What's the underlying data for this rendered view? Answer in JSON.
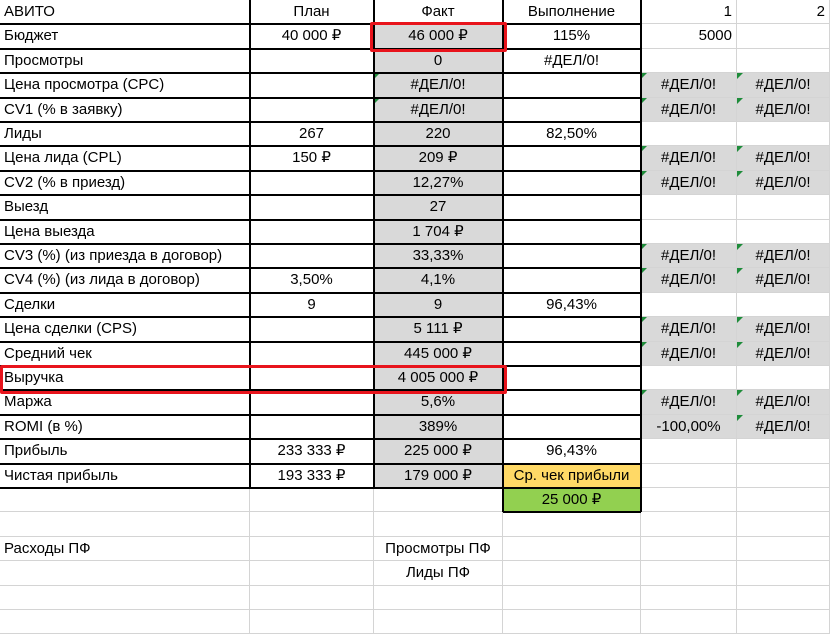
{
  "sheet": {
    "header": [
      "АВИТО",
      "План",
      "Факт",
      "Выполнение",
      "1",
      "2"
    ],
    "rows": [
      {
        "label": "Бюджет",
        "plan": "40 000 ₽",
        "fact": "46 000 ₽",
        "perf": "115%",
        "c1": "5000",
        "c2": ""
      },
      {
        "label": "Просмотры",
        "plan": "",
        "fact": "0",
        "perf": "#ДЕЛ/0!",
        "c1": "",
        "c2": ""
      },
      {
        "label": "Цена просмотра (CPC)",
        "plan": "",
        "fact": "#ДЕЛ/0!",
        "perf": "",
        "c1": "#ДЕЛ/0!",
        "c2": "#ДЕЛ/0!"
      },
      {
        "label": "CV1 (% в заявку)",
        "plan": "",
        "fact": "#ДЕЛ/0!",
        "perf": "",
        "c1": "#ДЕЛ/0!",
        "c2": "#ДЕЛ/0!"
      },
      {
        "label": "Лиды",
        "plan": "267",
        "fact": "220",
        "perf": "82,50%",
        "c1": "",
        "c2": ""
      },
      {
        "label": "Цена лида (CPL)",
        "plan": "150 ₽",
        "fact": "209 ₽",
        "perf": "",
        "c1": "#ДЕЛ/0!",
        "c2": "#ДЕЛ/0!"
      },
      {
        "label": "CV2 (% в приезд)",
        "plan": "",
        "fact": "12,27%",
        "perf": "",
        "c1": "#ДЕЛ/0!",
        "c2": "#ДЕЛ/0!"
      },
      {
        "label": "Выезд",
        "plan": "",
        "fact": "27",
        "perf": "",
        "c1": "",
        "c2": ""
      },
      {
        "label": "Цена выезда",
        "plan": "",
        "fact": "1 704 ₽",
        "perf": "",
        "c1": "",
        "c2": ""
      },
      {
        "label": "CV3 (%) (из приезда в договор)",
        "plan": "",
        "fact": "33,33%",
        "perf": "",
        "c1": "#ДЕЛ/0!",
        "c2": "#ДЕЛ/0!"
      },
      {
        "label": "CV4 (%) (из лида в договор)",
        "plan": "3,50%",
        "fact": "4,1%",
        "perf": "",
        "c1": "#ДЕЛ/0!",
        "c2": "#ДЕЛ/0!"
      },
      {
        "label": "Сделки",
        "plan": "9",
        "fact": "9",
        "perf": "96,43%",
        "c1": "",
        "c2": ""
      },
      {
        "label": "Цена сделки (CPS)",
        "plan": "",
        "fact": "5 111 ₽",
        "perf": "",
        "c1": "#ДЕЛ/0!",
        "c2": "#ДЕЛ/0!"
      },
      {
        "label": "Средний чек",
        "plan": "",
        "fact": "445 000 ₽",
        "perf": "",
        "c1": "#ДЕЛ/0!",
        "c2": "#ДЕЛ/0!"
      },
      {
        "label": "Выручка",
        "plan": "",
        "fact": "4 005 000 ₽",
        "perf": "",
        "c1": "",
        "c2": ""
      },
      {
        "label": "Маржа",
        "plan": "",
        "fact": "5,6%",
        "perf": "",
        "c1": "#ДЕЛ/0!",
        "c2": "#ДЕЛ/0!"
      },
      {
        "label": "ROMI (в %)",
        "plan": "",
        "fact": "389%",
        "perf": "",
        "c1": "-100,00%",
        "c2": "#ДЕЛ/0!"
      },
      {
        "label": "Прибыль",
        "plan": "233 333 ₽",
        "fact": "225 000 ₽",
        "perf": "96,43%",
        "c1": "",
        "c2": ""
      },
      {
        "label": "Чистая прибыль",
        "plan": "193 333 ₽",
        "fact": "179 000 ₽",
        "perf": "Ср. чек прибыли",
        "c1": "",
        "c2": ""
      },
      {
        "label": "",
        "plan": "",
        "fact": "",
        "perf": "25 000 ₽",
        "c1": "",
        "c2": ""
      },
      {
        "label": "",
        "plan": "",
        "fact": "",
        "perf": "",
        "c1": "",
        "c2": ""
      },
      {
        "label": "Расходы ПФ",
        "plan": "",
        "fact": "Просмотры ПФ",
        "perf": "",
        "c1": "",
        "c2": ""
      },
      {
        "label": "",
        "plan": "",
        "fact": "Лиды ПФ",
        "perf": "",
        "c1": "",
        "c2": ""
      },
      {
        "label": "",
        "plan": "",
        "fact": "",
        "perf": "",
        "c1": "",
        "c2": ""
      },
      {
        "label": "",
        "plan": "",
        "fact": "",
        "perf": "",
        "c1": "",
        "c2": ""
      }
    ]
  },
  "colors": {
    "fact_fill": "#d9d9d9",
    "avg_profit_fill": "#ffd966",
    "avg_profit_value_fill": "#92d050",
    "highlight_border": "#e8141c",
    "error_marker": "#1e8c3a"
  }
}
